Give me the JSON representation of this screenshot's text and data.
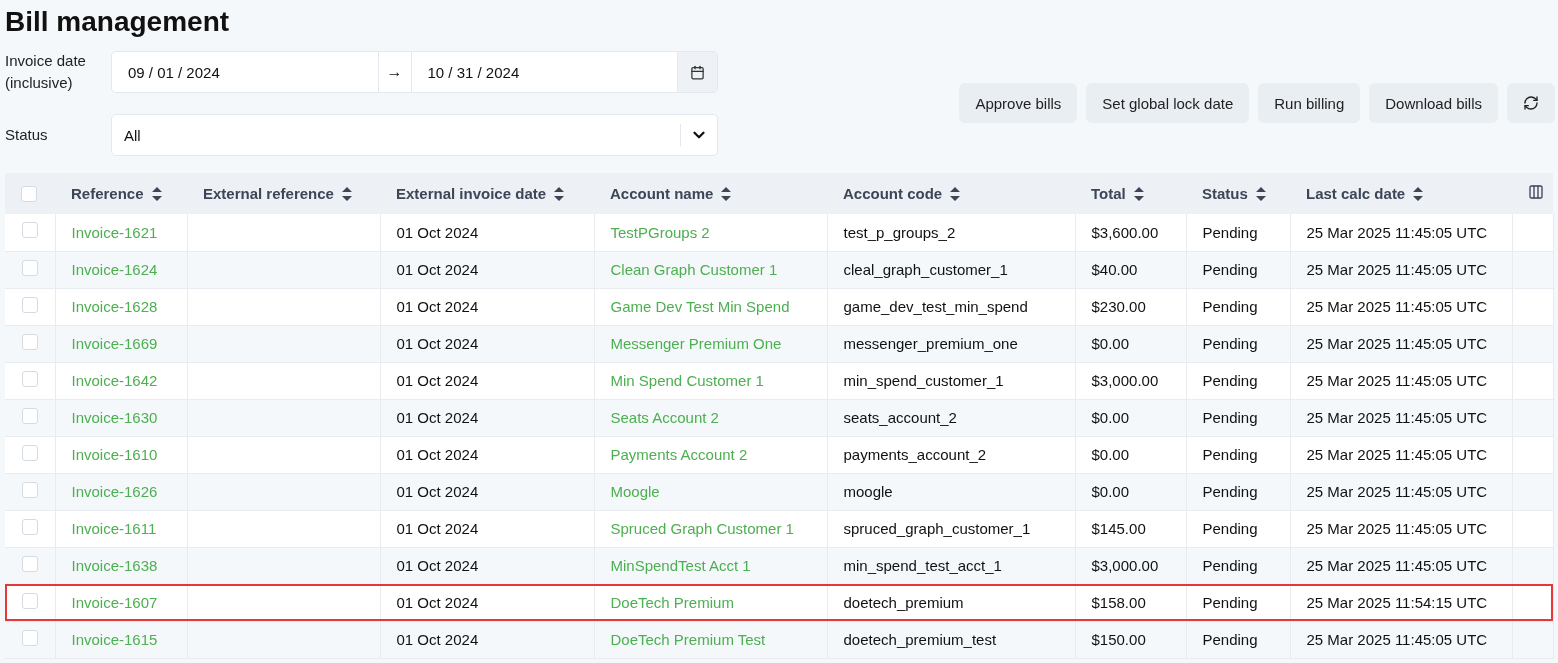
{
  "title": "Bill management",
  "filters": {
    "invoice_date_label": "Invoice date (inclusive)",
    "date_from": "09 / 01 / 2024",
    "date_arrow": "→",
    "date_to": "10 / 31 / 2024",
    "status_label": "Status",
    "status_value": "All"
  },
  "actions": [
    "Approve bills",
    "Set global lock date",
    "Run billing",
    "Download bills"
  ],
  "table": {
    "select_all_checked": false,
    "columns": [
      {
        "label": "Reference",
        "kind": "link"
      },
      {
        "label": "External reference",
        "kind": "text"
      },
      {
        "label": "External invoice date",
        "kind": "text"
      },
      {
        "label": "Account name",
        "kind": "link"
      },
      {
        "label": "Account code",
        "kind": "text"
      },
      {
        "label": "Total",
        "kind": "text"
      },
      {
        "label": "Status",
        "kind": "text"
      },
      {
        "label": "Last calc date",
        "kind": "text"
      }
    ],
    "rows": [
      {
        "checked": false,
        "highlighted": false,
        "cells": [
          "Invoice-1621",
          "",
          "01 Oct 2024",
          "TestPGroups 2",
          "test_p_groups_2",
          "$3,600.00",
          "Pending",
          "25 Mar 2025 11:45:05 UTC"
        ]
      },
      {
        "checked": false,
        "highlighted": false,
        "cells": [
          "Invoice-1624",
          "",
          "01 Oct 2024",
          "Clean Graph Customer 1",
          "cleal_graph_customer_1",
          "$40.00",
          "Pending",
          "25 Mar 2025 11:45:05 UTC"
        ]
      },
      {
        "checked": false,
        "highlighted": false,
        "cells": [
          "Invoice-1628",
          "",
          "01 Oct 2024",
          "Game Dev Test Min Spend",
          "game_dev_test_min_spend",
          "$230.00",
          "Pending",
          "25 Mar 2025 11:45:05 UTC"
        ]
      },
      {
        "checked": false,
        "highlighted": false,
        "cells": [
          "Invoice-1669",
          "",
          "01 Oct 2024",
          "Messenger Premium One",
          "messenger_premium_one",
          "$0.00",
          "Pending",
          "25 Mar 2025 11:45:05 UTC"
        ]
      },
      {
        "checked": false,
        "highlighted": false,
        "cells": [
          "Invoice-1642",
          "",
          "01 Oct 2024",
          "Min Spend Customer 1",
          "min_spend_customer_1",
          "$3,000.00",
          "Pending",
          "25 Mar 2025 11:45:05 UTC"
        ]
      },
      {
        "checked": false,
        "highlighted": false,
        "cells": [
          "Invoice-1630",
          "",
          "01 Oct 2024",
          "Seats Account 2",
          "seats_account_2",
          "$0.00",
          "Pending",
          "25 Mar 2025 11:45:05 UTC"
        ]
      },
      {
        "checked": false,
        "highlighted": false,
        "cells": [
          "Invoice-1610",
          "",
          "01 Oct 2024",
          "Payments Account 2",
          "payments_account_2",
          "$0.00",
          "Pending",
          "25 Mar 2025 11:45:05 UTC"
        ]
      },
      {
        "checked": false,
        "highlighted": false,
        "cells": [
          "Invoice-1626",
          "",
          "01 Oct 2024",
          "Moogle",
          "moogle",
          "$0.00",
          "Pending",
          "25 Mar 2025 11:45:05 UTC"
        ]
      },
      {
        "checked": false,
        "highlighted": false,
        "cells": [
          "Invoice-1611",
          "",
          "01 Oct 2024",
          "Spruced Graph Customer 1",
          "spruced_graph_customer_1",
          "$145.00",
          "Pending",
          "25 Mar 2025 11:45:05 UTC"
        ]
      },
      {
        "checked": false,
        "highlighted": false,
        "cells": [
          "Invoice-1638",
          "",
          "01 Oct 2024",
          "MinSpendTest Acct 1",
          "min_spend_test_acct_1",
          "$3,000.00",
          "Pending",
          "25 Mar 2025 11:45:05 UTC"
        ]
      },
      {
        "checked": false,
        "highlighted": true,
        "cells": [
          "Invoice-1607",
          "",
          "01 Oct 2024",
          "DoeTech Premium",
          "doetech_premium",
          "$158.00",
          "Pending",
          "25 Mar 2025 11:54:15 UTC"
        ]
      },
      {
        "checked": false,
        "highlighted": false,
        "cells": [
          "Invoice-1615",
          "",
          "01 Oct 2024",
          "DoeTech Premium Test",
          "doetech_premium_test",
          "$150.00",
          "Pending",
          "25 Mar 2025 11:45:05 UTC"
        ]
      }
    ]
  }
}
